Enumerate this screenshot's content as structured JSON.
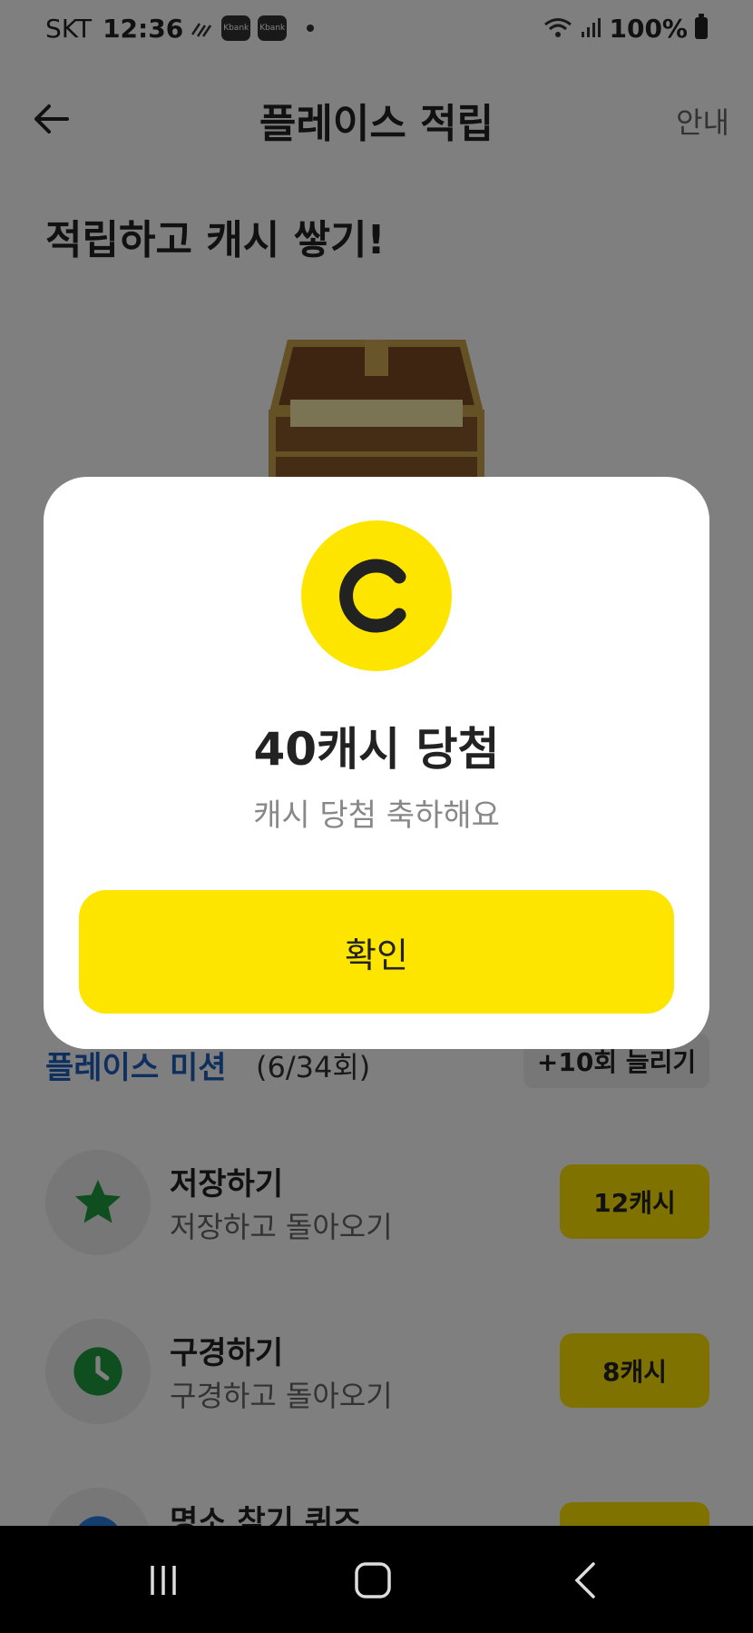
{
  "status_bar": {
    "carrier": "SKT",
    "time": "12:36",
    "notification_badges": [
      "Kbank",
      "Kbank"
    ],
    "battery": "100%"
  },
  "header": {
    "title": "플레이스 적립",
    "info_label": "안내"
  },
  "headline": "적립하고 캐시 쌓기!",
  "missions": {
    "title": "플레이스 미션",
    "count": "(6/34회)",
    "more_label": "+10회 늘리기",
    "items": [
      {
        "name": "저장하기",
        "desc": "저장하고 돌아오기",
        "reward": "12캐시",
        "icon": "star-icon"
      },
      {
        "name": "구경하기",
        "desc": "구경하고 돌아오기",
        "reward": "8캐시",
        "icon": "clock-icon"
      },
      {
        "name": "명소 찾기 퀴즈",
        "desc": "",
        "reward": "",
        "icon": "quiz-icon"
      }
    ]
  },
  "modal": {
    "coin_letter": "C",
    "title": "40캐시 당첨",
    "subtitle": "캐시 당첨 축하해요",
    "confirm_label": "확인"
  },
  "colors": {
    "accent_yellow": "#fee500",
    "mission_blue": "#1f5fbf",
    "icon_green": "#1e9e3e"
  }
}
